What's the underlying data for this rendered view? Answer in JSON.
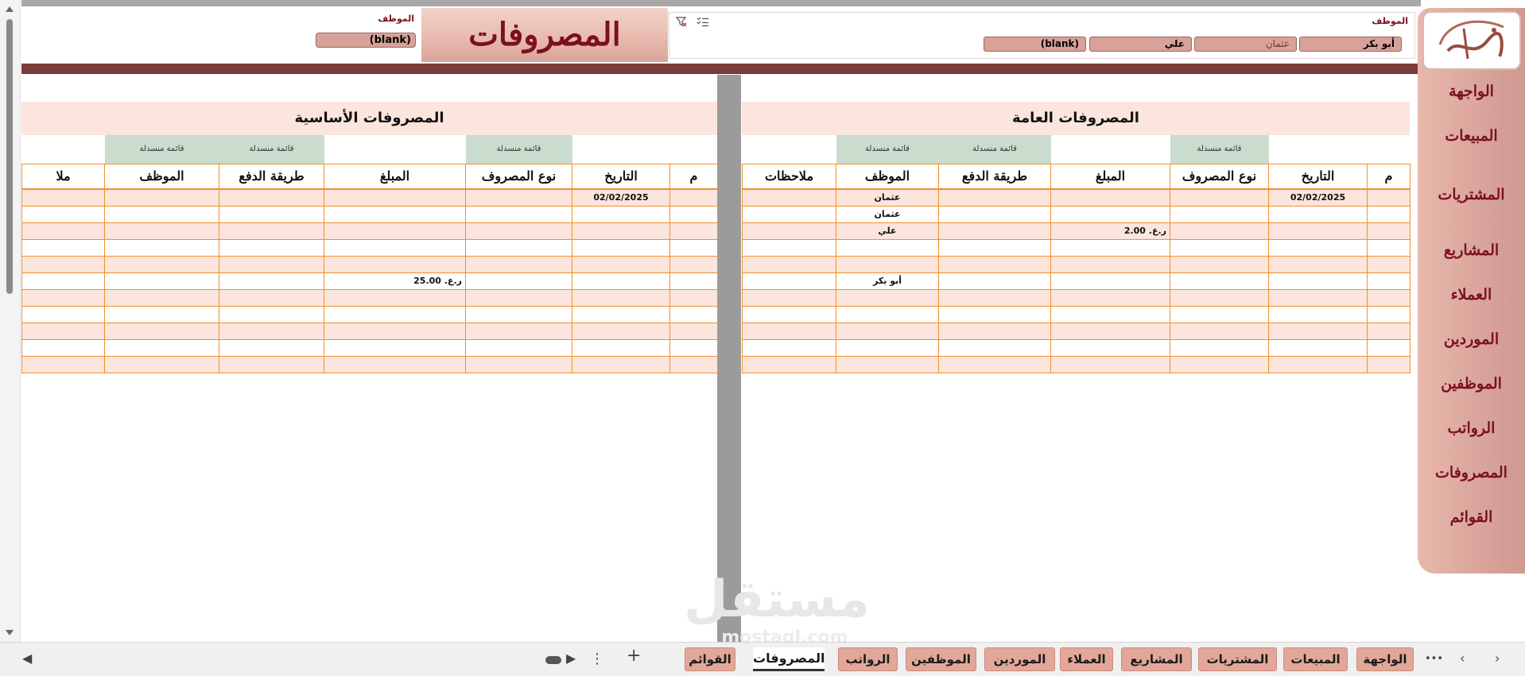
{
  "app": {
    "title": "المصروفات"
  },
  "header": {
    "left_label": "الموظف",
    "left_slicer_value": "(blank)",
    "right_label": "الموظف",
    "right_slicers": [
      "أبو بكر",
      "عثمان",
      "علي",
      "(blank)"
    ],
    "filter_icons": [
      "multi-select-icon",
      "clear-filter-icon"
    ]
  },
  "nav": {
    "items": [
      "الواجهة",
      "المبيعات",
      "المشتريات",
      "المشاريع",
      "العملاء",
      "الموردين",
      "الموظفين",
      "الرواتب",
      "المصروفات",
      "القوائم"
    ]
  },
  "general_expenses": {
    "title": "المصروفات العامة",
    "tag_label": "قائمة منسدلة",
    "columns": [
      "م",
      "التاريخ",
      "نوع المصروف",
      "المبلغ",
      "طريقة الدفع",
      "الموظف",
      "ملاحظات"
    ],
    "rows": [
      [
        "",
        "02/02/2025",
        "",
        "",
        "",
        "عثمان",
        ""
      ],
      [
        "",
        "",
        "",
        "",
        "",
        "عثمان",
        ""
      ],
      [
        "",
        "",
        "",
        "ر.ع. 2.00",
        "",
        "علي",
        ""
      ],
      [
        "",
        "",
        "",
        "",
        "",
        "",
        ""
      ],
      [
        "",
        "",
        "",
        "",
        "",
        "",
        ""
      ],
      [
        "",
        "",
        "",
        "",
        "",
        "أبو بكر",
        ""
      ],
      [
        "",
        "",
        "",
        "",
        "",
        "",
        ""
      ],
      [
        "",
        "",
        "",
        "",
        "",
        "",
        ""
      ],
      [
        "",
        "",
        "",
        "",
        "",
        "",
        ""
      ],
      [
        "",
        "",
        "",
        "",
        "",
        "",
        ""
      ],
      [
        "",
        "",
        "",
        "",
        "",
        "",
        ""
      ]
    ]
  },
  "basic_expenses": {
    "title": "المصروفات الأساسية",
    "tag_label": "قائمة منسدلة",
    "columns": [
      "م",
      "التاريخ",
      "نوع المصروف",
      "المبلغ",
      "طريقة الدفع",
      "الموظف",
      "ملا"
    ],
    "rows": [
      [
        "",
        "02/02/2025",
        "",
        "",
        "",
        "",
        ""
      ],
      [
        "",
        "",
        "",
        "",
        "",
        "",
        ""
      ],
      [
        "",
        "",
        "",
        "",
        "",
        "",
        ""
      ],
      [
        "",
        "",
        "",
        "",
        "",
        "",
        ""
      ],
      [
        "",
        "",
        "",
        "",
        "",
        "",
        ""
      ],
      [
        "",
        "",
        "",
        "ر.ع. 25.00",
        "",
        "",
        ""
      ],
      [
        "",
        "",
        "",
        "",
        "",
        "",
        ""
      ],
      [
        "",
        "",
        "",
        "",
        "",
        "",
        ""
      ],
      [
        "",
        "",
        "",
        "",
        "",
        "",
        ""
      ],
      [
        "",
        "",
        "",
        "",
        "",
        "",
        ""
      ],
      [
        "",
        "",
        "",
        "",
        "",
        "",
        ""
      ]
    ]
  },
  "sheet_tabs": {
    "items": [
      "الواجهة",
      "المبيعات",
      "المشتريات",
      "المشاريع",
      "العملاء",
      "الموردين",
      "الموظفين",
      "الرواتب",
      "المصروفات",
      "القوائم"
    ],
    "active": "المصروفات",
    "more_glyph": "•••",
    "add_glyph": "+",
    "menu_glyph": "⋮"
  },
  "watermark": {
    "text": "مستقل",
    "sub": "mostaql.com"
  }
}
